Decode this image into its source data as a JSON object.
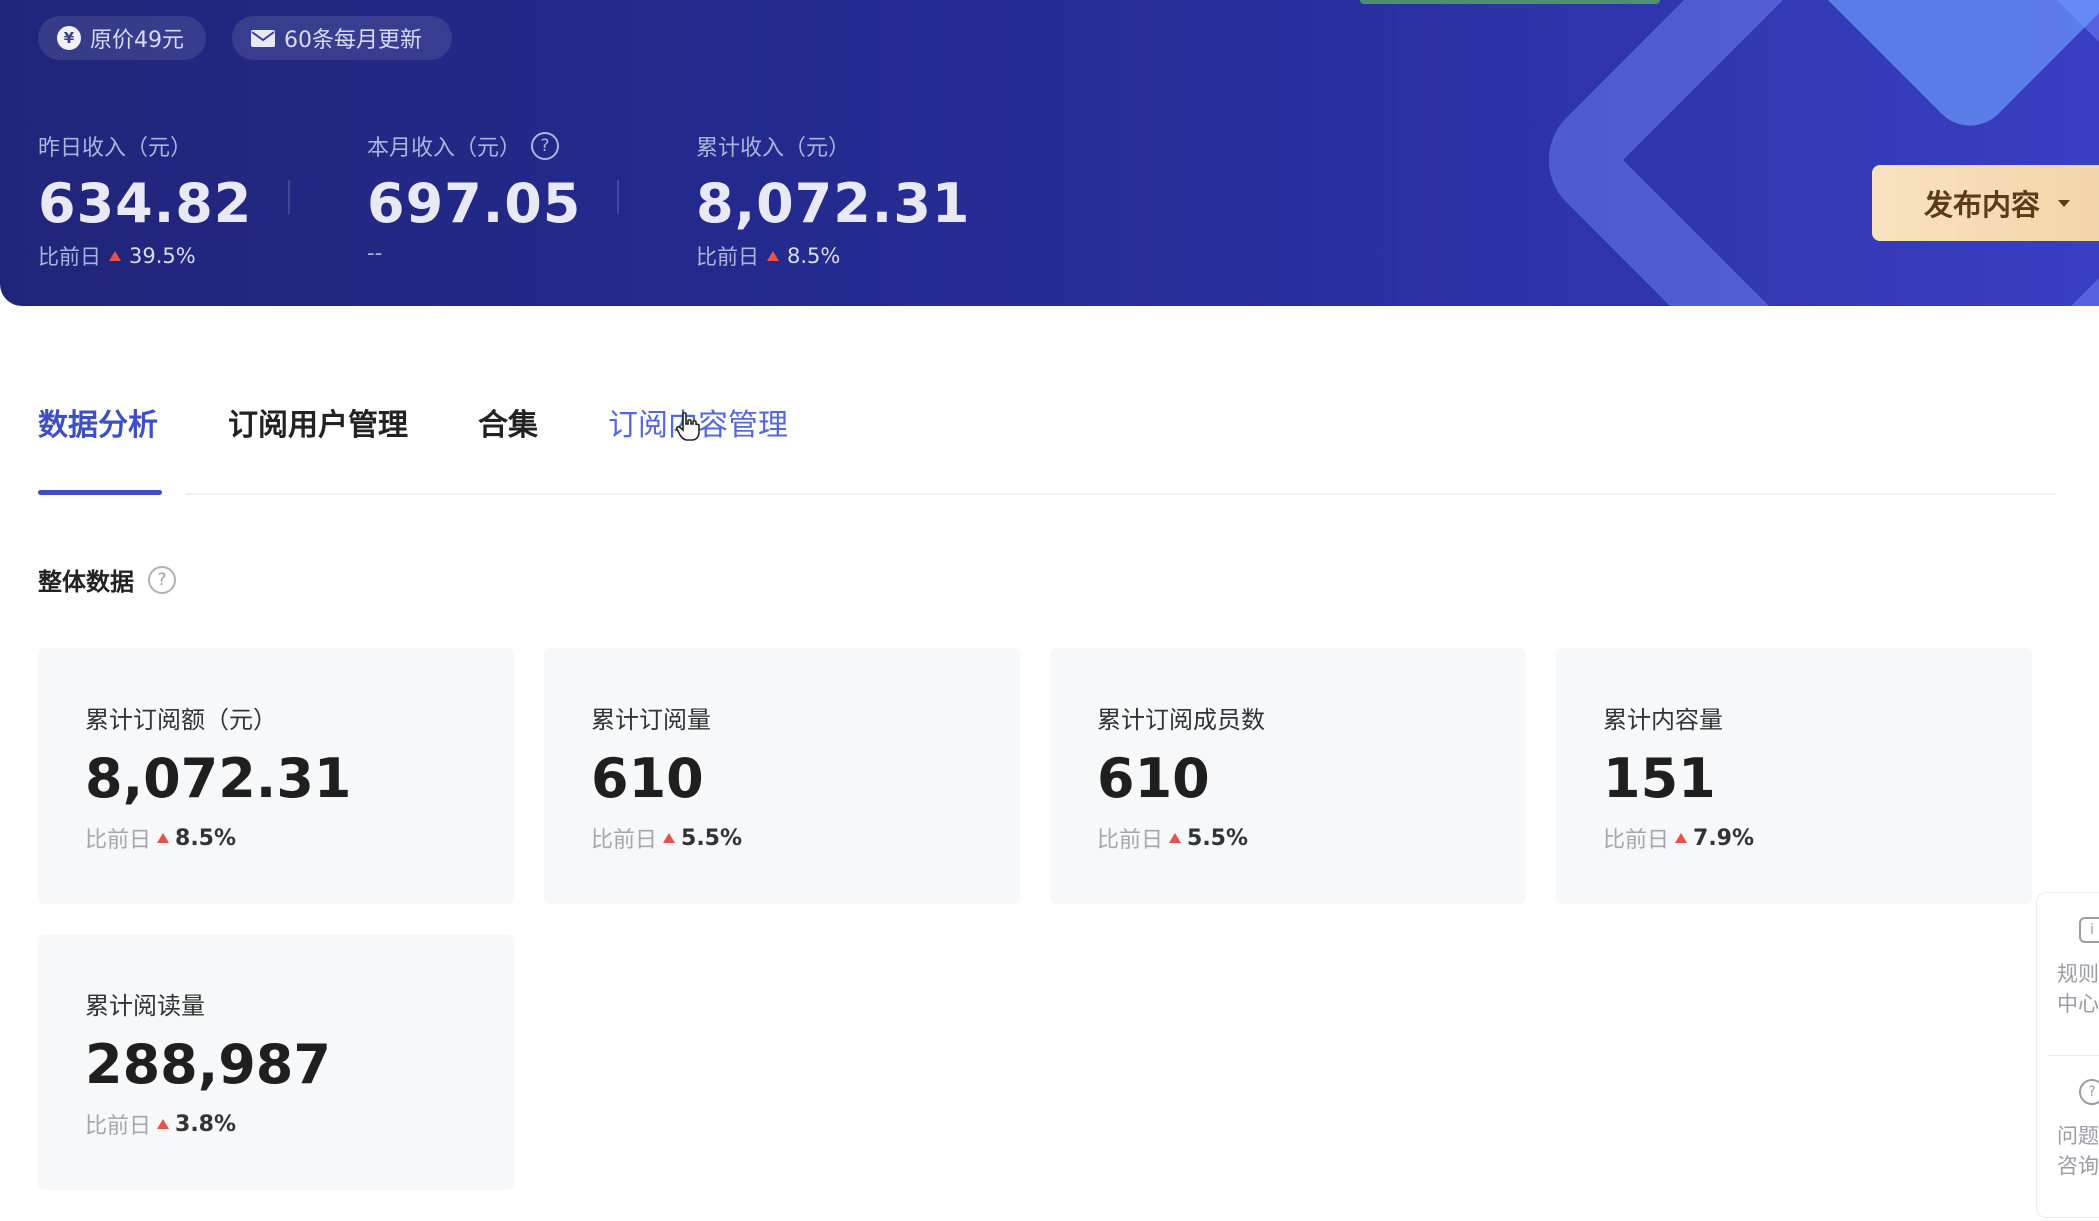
{
  "hero": {
    "pill_price": "原价49元",
    "pill_update": "60条每月更新",
    "stats": [
      {
        "label": "昨日收入（元）",
        "value": "634.82",
        "cmp_label": "比前日",
        "cmp_pct": "39.5%"
      },
      {
        "label": "本月收入（元）",
        "value": "697.05",
        "cmp_label": "--"
      },
      {
        "label": "累计收入（元）",
        "value": "8,072.31",
        "cmp_label": "比前日",
        "cmp_pct": "8.5%"
      }
    ],
    "publish_button": "发布内容"
  },
  "tabs": [
    {
      "label": "数据分析",
      "state": "active"
    },
    {
      "label": "订阅用户管理"
    },
    {
      "label": "合集"
    },
    {
      "label": "订阅内容管理",
      "state": "hover"
    }
  ],
  "section": {
    "title": "整体数据"
  },
  "cards": [
    {
      "label": "累计订阅额（元）",
      "value": "8,072.31",
      "cmp_label": "比前日",
      "cmp_pct": "8.5%"
    },
    {
      "label": "累计订阅量",
      "value": "610",
      "cmp_label": "比前日",
      "cmp_pct": "5.5%"
    },
    {
      "label": "累计订阅成员数",
      "value": "610",
      "cmp_label": "比前日",
      "cmp_pct": "5.5%"
    },
    {
      "label": "累计内容量",
      "value": "151",
      "cmp_label": "比前日",
      "cmp_pct": "7.9%"
    },
    {
      "label": "累计阅读量",
      "value": "288,987",
      "cmp_label": "比前日",
      "cmp_pct": "3.8%"
    }
  ],
  "float_panel": {
    "rules_line1": "规则",
    "rules_line2": "中心",
    "help_line1": "问题",
    "help_line2": "咨询"
  },
  "colors": {
    "accent": "#3d4fc4",
    "hero_bg": "#232a8c",
    "publish_bg": "#f6dcb4",
    "up_arrow": "#e5524a"
  }
}
